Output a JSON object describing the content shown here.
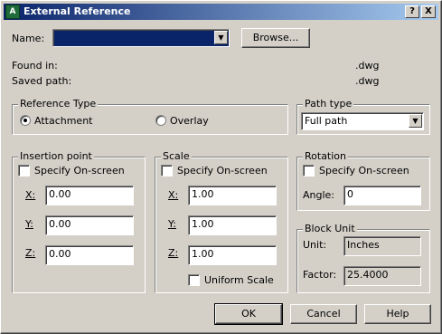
{
  "window": {
    "title": "External Reference",
    "help_btn": "?",
    "close_btn": "X"
  },
  "name": {
    "label": "Name:",
    "value": "",
    "browse_label": "Browse..."
  },
  "info": {
    "found_in_label": "Found in:",
    "found_in_value": ".dwg",
    "saved_path_label": "Saved path:",
    "saved_path_value": ".dwg"
  },
  "reference_type": {
    "title": "Reference Type",
    "options": [
      "Attachment",
      "Overlay"
    ],
    "selected": "Attachment"
  },
  "path_type": {
    "title": "Path type",
    "selected": "Full path"
  },
  "insertion": {
    "title": "Insertion point",
    "specify_label": "Specify On-screen",
    "x_label": "X:",
    "x_value": "0.00",
    "y_label": "Y:",
    "y_value": "0.00",
    "z_label": "Z:",
    "z_value": "0.00"
  },
  "scale": {
    "title": "Scale",
    "specify_label": "Specify On-screen",
    "x_label": "X:",
    "x_value": "1.00",
    "y_label": "Y:",
    "y_value": "1.00",
    "z_label": "Z:",
    "z_value": "1.00",
    "uniform_label": "Uniform Scale"
  },
  "rotation": {
    "title": "Rotation",
    "specify_label": "Specify On-screen",
    "angle_label": "Angle:",
    "angle_value": "0"
  },
  "block_unit": {
    "title": "Block Unit",
    "unit_label": "Unit:",
    "unit_value": "Inches",
    "factor_label": "Factor:",
    "factor_value": "25.4000"
  },
  "buttons": {
    "ok": "OK",
    "cancel": "Cancel",
    "help": "Help"
  },
  "colors": {
    "title_start": "#0a246a",
    "title_end": "#a6caf0",
    "selection": "#0a246a",
    "face": "#d4d0c8"
  }
}
